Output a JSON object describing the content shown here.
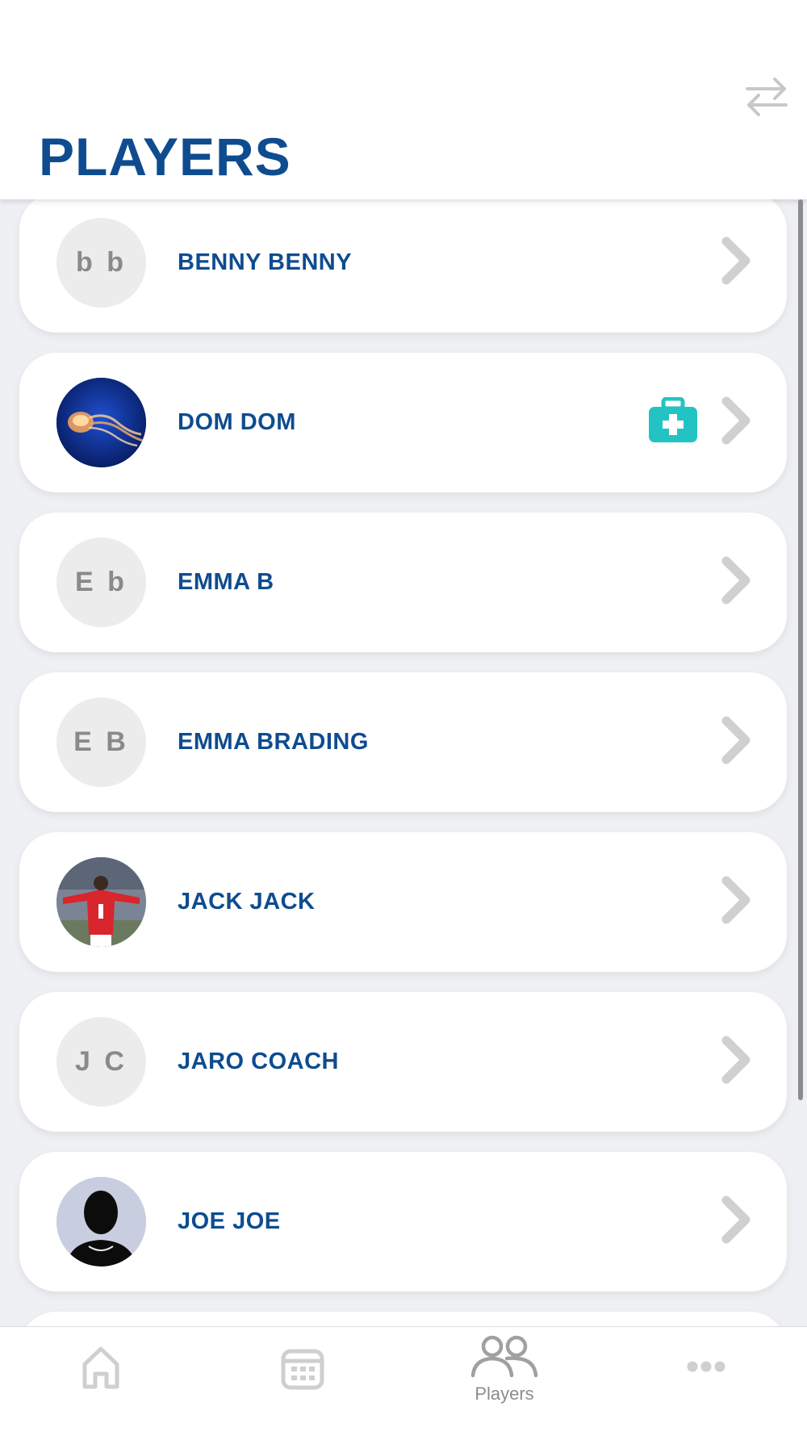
{
  "header": {
    "title": "PLAYERS",
    "switch_icon": "swap-arrows-icon"
  },
  "players": [
    {
      "name": "BENNY BENNY",
      "initials": "b b",
      "avatar": "initials",
      "medical": false
    },
    {
      "name": "DOM DOM",
      "initials": "",
      "avatar": "jellyfish-photo",
      "medical": true
    },
    {
      "name": "EMMA B",
      "initials": "E b",
      "avatar": "initials",
      "medical": false
    },
    {
      "name": "EMMA BRADING",
      "initials": "E B",
      "avatar": "initials",
      "medical": false
    },
    {
      "name": "JACK JACK",
      "initials": "",
      "avatar": "football-player-photo",
      "medical": false
    },
    {
      "name": "JARO COACH",
      "initials": "J C",
      "avatar": "initials",
      "medical": false
    },
    {
      "name": "JOE JOE",
      "initials": "",
      "avatar": "silhouette-photo",
      "medical": false
    }
  ],
  "tabbar": {
    "tabs": [
      {
        "id": "home",
        "label": "",
        "icon": "home-icon",
        "active": false
      },
      {
        "id": "calendar",
        "label": "",
        "icon": "calendar-icon",
        "active": false
      },
      {
        "id": "players",
        "label": "Players",
        "icon": "players-icon",
        "active": true
      },
      {
        "id": "more",
        "label": "",
        "icon": "more-dots-icon",
        "active": false
      }
    ]
  },
  "colors": {
    "accent": "#0e4c8f",
    "medical": "#23c3c3",
    "muted": "#a8a8a8",
    "background": "#eef0f3"
  }
}
